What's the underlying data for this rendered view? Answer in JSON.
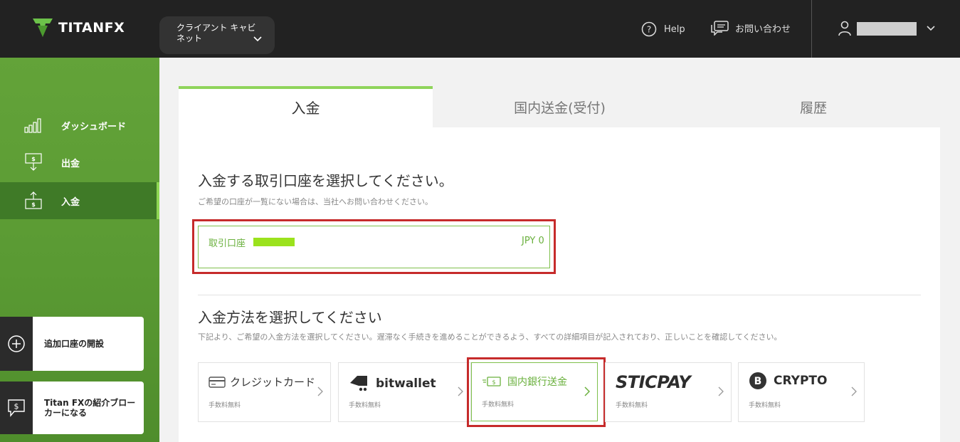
{
  "header": {
    "logo_text": "TITANFX",
    "cabinet_label": "クライアント キャビネット",
    "help_label": "Help",
    "contact_label": "お問い合わせ"
  },
  "sidebar": {
    "items": [
      {
        "label": "ダッシュボード",
        "icon": "bar-chart-icon"
      },
      {
        "label": "出金",
        "icon": "withdraw-icon"
      },
      {
        "label": "入金",
        "icon": "deposit-icon",
        "active": true
      }
    ],
    "cards": [
      {
        "label": "追加口座の開設",
        "icon": "plus-circle-icon"
      },
      {
        "label": "Titan FXの紹介ブローカーになる",
        "icon": "dollar-chat-icon"
      }
    ]
  },
  "tabs": [
    {
      "label": "入金",
      "active": true
    },
    {
      "label": "国内送金(受付)"
    },
    {
      "label": "履歴"
    }
  ],
  "account_section": {
    "title": "入金する取引口座を選択してください。",
    "subtitle": "ご希望の口座が一覧にない場合は、当社へお問い合わせください。",
    "account_label": "取引口座",
    "balance": "JPY 0"
  },
  "method_section": {
    "title": "入金方法を選択してください",
    "subtitle": "下記より、ご希望の入金方法を選択してください。遅滞なく手続きを進めることができるよう、すべての詳細項目が記入されており、正しいことを確認してください。",
    "methods": [
      {
        "name": "クレジットカード",
        "fee": "手数料無料",
        "icon": "credit-card-icon"
      },
      {
        "name": "bitwallet",
        "fee": "手数料無料",
        "icon": "bitwallet-icon"
      },
      {
        "name": "国内銀行送金",
        "fee": "手数料無料",
        "icon": "bank-transfer-icon",
        "selected": true
      },
      {
        "name": "STICPAY",
        "fee": "手数料無料",
        "icon": "sticpay-logo"
      },
      {
        "name": "CRYPTO",
        "fee": "手数料無料",
        "icon": "bitcoin-icon"
      }
    ]
  },
  "colors": {
    "header_bg": "#222222",
    "sidebar_green": "#5a9a33",
    "accent_green": "#8fd45b",
    "highlight_red": "#c62b2b"
  }
}
